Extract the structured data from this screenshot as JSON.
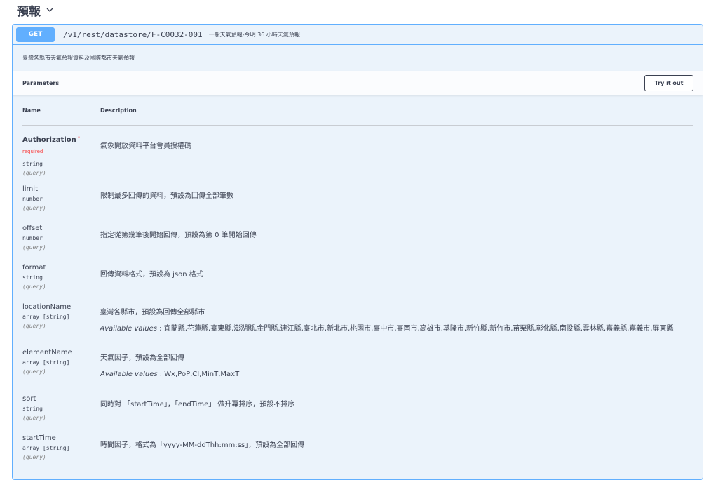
{
  "tag": {
    "title": "預報"
  },
  "operation": {
    "method": "GET",
    "path": "/v1/rest/datastore/F-C0032-001",
    "summary": "一般天氣預報-今明 36 小時天氣預報",
    "description": "臺灣各縣市天氣預報資料及國際都市天氣預報"
  },
  "parameters_section": {
    "title": "Parameters",
    "try_button": "Try it out",
    "col_name": "Name",
    "col_description": "Description",
    "required_label": "* required",
    "available_label": "Available values",
    "items": [
      {
        "name": "Authorization",
        "type": "string",
        "in": "(query)",
        "description": "氣象開放資料平台會員授權碼",
        "required": true
      },
      {
        "name": "limit",
        "type": "number",
        "in": "(query)",
        "description": "限制最多回傳的資料，預設為回傳全部筆數"
      },
      {
        "name": "offset",
        "type": "number",
        "in": "(query)",
        "description": "指定從第幾筆後開始回傳，預設為第 0 筆開始回傳"
      },
      {
        "name": "format",
        "type": "string",
        "in": "(query)",
        "description": "回傳資料格式，預設為 json 格式"
      },
      {
        "name": "locationName",
        "type": "array [string]",
        "in": "(query)",
        "description": "臺灣各縣市，預設為回傳全部縣市",
        "available_values": "宜蘭縣,花蓮縣,臺東縣,澎湖縣,金門縣,連江縣,臺北市,新北市,桃園市,臺中市,臺南市,高雄市,基隆市,新竹縣,新竹市,苗栗縣,彰化縣,南投縣,雲林縣,嘉義縣,嘉義市,屏東縣"
      },
      {
        "name": "elementName",
        "type": "array [string]",
        "in": "(query)",
        "description": "天氣因子，預設為全部回傳",
        "available_values": "Wx,PoP,CI,MinT,MaxT"
      },
      {
        "name": "sort",
        "type": "string",
        "in": "(query)",
        "description": "同時對 「startTime」，「endTime」 做升冪排序，預設不排序"
      },
      {
        "name": "startTime",
        "type": "array [string]",
        "in": "(query)",
        "description": "時間因子，格式為「yyyy-MM-ddThh:mm:ss」，預設為全部回傳"
      }
    ]
  }
}
